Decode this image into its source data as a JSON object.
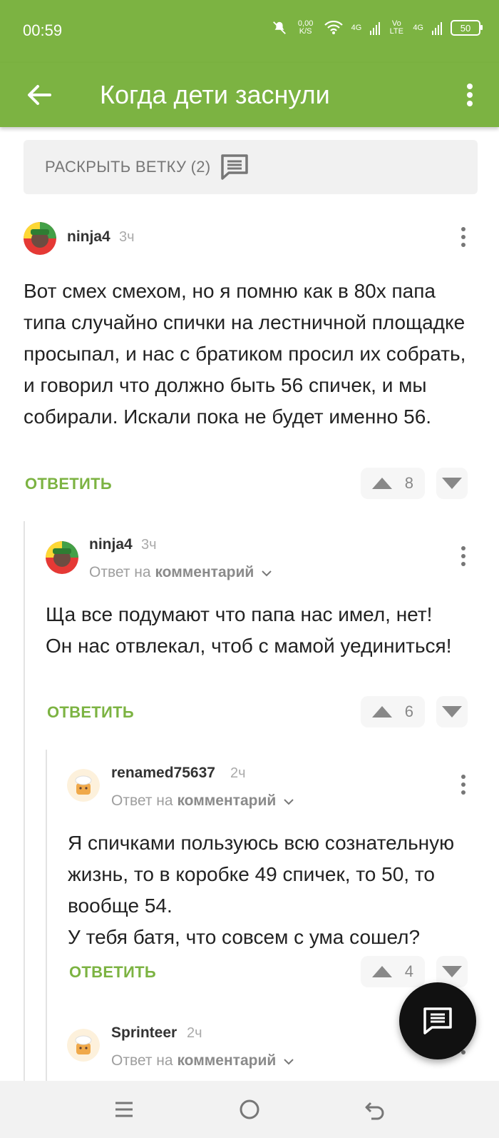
{
  "status_bar": {
    "time": "00:59",
    "net_speed": "0,00 K/S",
    "volte": "Vo LTE",
    "network_4g_1": "4G",
    "network_4g_2": "4G",
    "battery": "50"
  },
  "app_bar": {
    "title": "Когда дети заснули",
    "back_icon": "arrow-left-icon",
    "menu_icon": "more-vertical-icon"
  },
  "expand_branch": {
    "label": "РАСКРЫТЬ ВЕТКУ (2)",
    "icon": "comment-icon"
  },
  "comments": [
    {
      "author": "ninja4",
      "time": "3ч",
      "text": "Вот смех смехом, но я помню как в 80х папа типа случайно спички на лестничной площадке просыпал, и нас с братиком просил их собрать, и говорил что должно быть 56 спичек, и мы собирали. Искали пока не будет именно 56.",
      "reply_label": "ОТВЕТИТЬ",
      "votes": "8"
    },
    {
      "author": "ninja4",
      "time": "3ч",
      "reply_to_prefix": "Ответ на",
      "reply_to_target": "комментарий",
      "text": "Ща все подумают что папа нас имел, нет! Он нас отвлекал, чтоб с мамой уединиться!",
      "reply_label": "ОТВЕТИТЬ",
      "votes": "6"
    },
    {
      "author": "renamed75637",
      "time": "2ч",
      "reply_to_prefix": "Ответ на",
      "reply_to_target": "комментарий",
      "text": "Я спичками пользуюсь всю сознательную жизнь, то в коробке 49 спичек, то 50, то вообще 54.\nУ тебя батя, что совсем с ума сошел?",
      "reply_label": "ОТВЕТИТЬ",
      "votes": "4"
    },
    {
      "author": "Sprinteer",
      "time": "2ч",
      "reply_to_prefix": "Ответ на",
      "reply_to_target": "комментарий"
    }
  ],
  "fab": {
    "icon": "comment-icon"
  },
  "nav_bar": {
    "icons": [
      "menu-icon",
      "home-icon",
      "back-icon"
    ]
  },
  "colors": {
    "accent": "#7cb342",
    "fab": "#111111"
  }
}
